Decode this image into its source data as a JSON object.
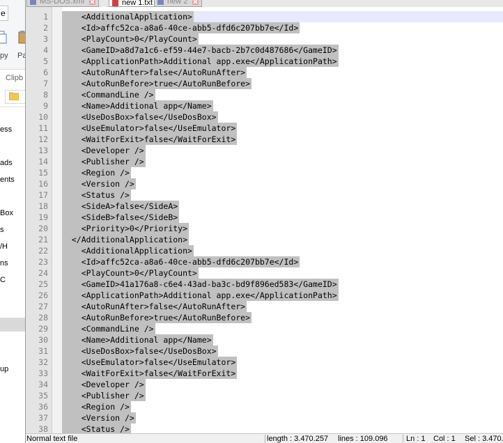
{
  "left_pane": {
    "ribbon_tab": "e",
    "copy_label": "py",
    "paste_label": "Pa",
    "clipboard_label": "Clipb",
    "nav_items": [
      "ess",
      "ads",
      "ents",
      "Box",
      "s",
      "/H",
      "ns",
      "C",
      "up"
    ]
  },
  "tabs": [
    {
      "label": "MS-DOS.xml",
      "active": false
    },
    {
      "label": "new 1.txt",
      "active": true
    },
    {
      "label": "new 2",
      "active": false
    }
  ],
  "editor": {
    "lines": [
      "    <AdditionalApplication>",
      "    <Id>affc52ca-a8a6-40ce-abb5-dfd6c207bb7e</Id>",
      "    <PlayCount>0</PlayCount>",
      "    <GameID>a8d7a1c6-ef59-44e7-bacb-2b7c0d487686</GameID>",
      "    <ApplicationPath>Additional app.exe</ApplicationPath>",
      "    <AutoRunAfter>false</AutoRunAfter>",
      "    <AutoRunBefore>true</AutoRunBefore>",
      "    <CommandLine />",
      "    <Name>Additional app</Name>",
      "    <UseDosBox>false</UseDosBox>",
      "    <UseEmulator>false</UseEmulator>",
      "    <WaitForExit>false</WaitForExit>",
      "    <Developer />",
      "    <Publisher />",
      "    <Region />",
      "    <Version />",
      "    <Status />",
      "    <SideA>false</SideA>",
      "    <SideB>false</SideB>",
      "    <Priority>0</Priority>",
      "  </AdditionalApplication>",
      "    <AdditionalApplication>",
      "    <Id>affc52ca-a8a6-40ce-abb5-dfd6c207bb7e</Id>",
      "    <PlayCount>0</PlayCount>",
      "    <GameID>41a176a8-c6e4-43ad-ba3c-bd9f896ed583</GameID>",
      "    <ApplicationPath>Additional app.exe</ApplicationPath>",
      "    <AutoRunAfter>false</AutoRunAfter>",
      "    <AutoRunBefore>true</AutoRunBefore>",
      "    <CommandLine />",
      "    <Name>Additional app</Name>",
      "    <UseDosBox>false</UseDosBox>",
      "    <UseEmulator>false</UseEmulator>",
      "    <WaitForExit>false</WaitForExit>",
      "    <Developer />",
      "    <Publisher />",
      "    <Region />",
      "    <Version />",
      "    <Status />"
    ]
  },
  "status": {
    "file_type": "Normal text file",
    "length": "length : 3.470.257",
    "lines": "lines : 109.096",
    "ln": "Ln : 1",
    "col": "Col : 1",
    "sel": "Sel : 3.470."
  },
  "colors": {
    "selection": "#c0c0c0",
    "gutter": "#e4e4e4",
    "active_tab_accent": "#f5a25a"
  }
}
